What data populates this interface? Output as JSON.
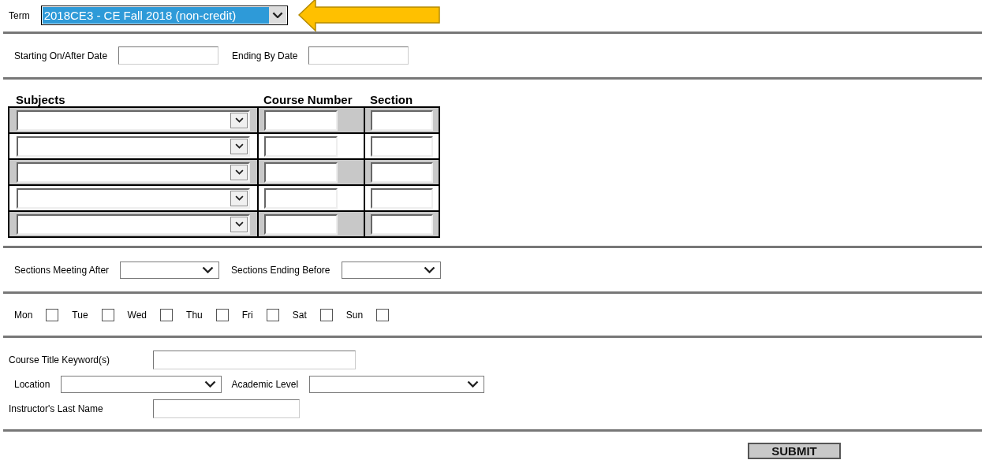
{
  "term": {
    "label": "Term",
    "value": "2018CE3 - CE Fall 2018 (non-credit)",
    "selected": true
  },
  "dates": [
    {
      "label": "Starting On/After Date"
    },
    {
      "label": "Ending By Date"
    }
  ],
  "course_table": {
    "columns": [
      "Subjects",
      "Course Number",
      "Section"
    ],
    "rows": [
      {
        "kind": "shaded"
      },
      {
        "kind": "plain"
      },
      {
        "kind": "shaded"
      },
      {
        "kind": "plain"
      },
      {
        "kind": "shaded"
      }
    ]
  },
  "times": [
    {
      "label": "Sections Meeting After"
    },
    {
      "label": "Sections Ending Before"
    }
  ],
  "days": [
    {
      "label": "Mon",
      "checked": false
    },
    {
      "label": "Tue",
      "checked": false
    },
    {
      "label": "Wed",
      "checked": false
    },
    {
      "label": "Thu",
      "checked": false
    },
    {
      "label": "Fri",
      "checked": false
    },
    {
      "label": "Sat",
      "checked": false
    },
    {
      "label": "Sun",
      "checked": false
    }
  ],
  "keyword": {
    "label": "Course Title Keyword(s)"
  },
  "location": {
    "label": "Location"
  },
  "academic_level": {
    "label": "Academic Level"
  },
  "instructor": {
    "label": "Instructor's Last Name"
  },
  "submit": "SUBMIT"
}
